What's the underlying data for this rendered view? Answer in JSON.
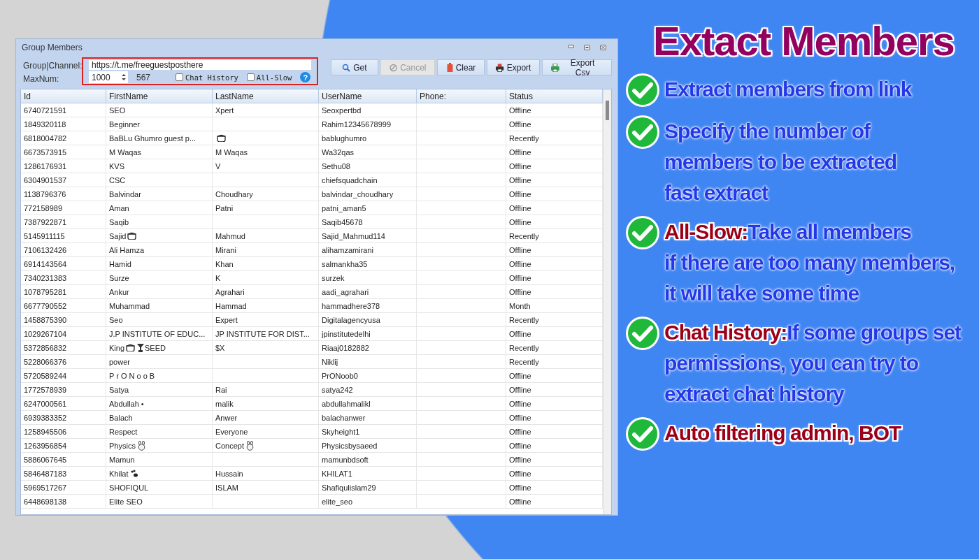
{
  "window": {
    "title": "Group Members"
  },
  "form": {
    "channel_label": "Group|Channel:",
    "channel_value": "https://t.me/freeguestposthere",
    "maxnum_label": "MaxNum:",
    "maxnum_value": "1000",
    "count": "567",
    "help": "?",
    "checkboxes": [
      {
        "label": "Chat History",
        "checked": false
      },
      {
        "label": "All-Slow",
        "checked": false
      }
    ]
  },
  "buttons": [
    {
      "label": "Get",
      "kind": "search",
      "disabled": false
    },
    {
      "label": "Cancel",
      "kind": "cancel",
      "disabled": true
    },
    {
      "label": "Clear",
      "kind": "clear",
      "disabled": false
    },
    {
      "label": "Export",
      "kind": "export",
      "disabled": false
    },
    {
      "label": "Export Csv",
      "kind": "csv",
      "disabled": false
    }
  ],
  "table": {
    "columns": [
      "Id",
      "FirstName",
      "LastName",
      "UserName",
      "Phone:",
      "Status"
    ],
    "rows": [
      [
        "6740721591",
        "SEO",
        "Xpert",
        "Seoxpertbd",
        "",
        "Offline"
      ],
      [
        "1849320118",
        "Beginner",
        "",
        "Rahim12345678999",
        "",
        "Offline"
      ],
      [
        "6818004782",
        "BaBLu Ghumro guest p...",
        [
          {
            "kind": "pot"
          }
        ],
        "bablughumro",
        "",
        "Recently"
      ],
      [
        "6673573915",
        "M Waqas",
        "M Waqas",
        "Wa32qas",
        "",
        "Offline"
      ],
      [
        "1286176931",
        "KVS",
        "V",
        "Sethu08",
        "",
        "Offline"
      ],
      [
        "6304901537",
        "CSC",
        "",
        "chiefsquadchain",
        "",
        "Offline"
      ],
      [
        "1138796376",
        "Balvindar",
        "Choudhary",
        "balvindar_choudhary",
        "",
        "Offline"
      ],
      [
        "772158989",
        "Aman",
        "Patni",
        "patni_aman5",
        "",
        "Offline"
      ],
      [
        "7387922871",
        "Saqib",
        "",
        "Saqib45678",
        "",
        "Offline"
      ],
      [
        "5145911115",
        [
          "Sajid",
          {
            "kind": "pot"
          }
        ],
        "Mahmud",
        "Sajid_Mahmud114",
        "",
        "Recently"
      ],
      [
        "7106132426",
        "Ali Hamza",
        "Mirani",
        "alihamzamirani",
        "",
        "Offline"
      ],
      [
        "6914143564",
        "Hamid",
        "Khan",
        "salmankha35",
        "",
        "Offline"
      ],
      [
        "7340231383",
        "Surze",
        "K",
        "surzek",
        "",
        "Offline"
      ],
      [
        "1078795281",
        "Ankur",
        "Agrahari",
        "aadi_agrahari",
        "",
        "Offline"
      ],
      [
        "6677790552",
        "Muhammad",
        "Hammad",
        "hammadhere378",
        "",
        "Month"
      ],
      [
        "1458875390",
        "Seo",
        "Expert",
        "Digitalagencyusa",
        "",
        "Recently"
      ],
      [
        "1029267104",
        "J.P INSTITUTE OF EDUC...",
        "JP INSTITUTE FOR DIST...",
        "jpinstitutedelhi",
        "",
        "Offline"
      ],
      [
        "5372856832",
        [
          "King",
          {
            "kind": "pot"
          },
          {
            "kind": "trophy"
          },
          "SEED"
        ],
        "$X",
        "Riaaj0182882",
        "",
        "Recently"
      ],
      [
        "5228066376",
        "power",
        "",
        "Niklij",
        "",
        "Recently"
      ],
      [
        "5720589244",
        "P r O N o o B",
        "",
        "PrONoob0",
        "",
        "Offline"
      ],
      [
        "1772578939",
        "Satya",
        "Rai",
        "satya242",
        "",
        "Offline"
      ],
      [
        "6247000561",
        "Abdullah •",
        "malik",
        "abdullahmalikl",
        "",
        "Offline"
      ],
      [
        "6939383352",
        "Balach",
        "Anwer",
        "balachanwer",
        "",
        "Offline"
      ],
      [
        "1258945506",
        "Respect",
        "Everyone",
        "Skyheight1",
        "",
        "Offline"
      ],
      [
        "1263956854",
        [
          "Physics",
          {
            "kind": "bunny"
          }
        ],
        [
          "Concept",
          {
            "kind": "bunny"
          }
        ],
        "Physicsbysaeed",
        "",
        "Offline"
      ],
      [
        "5886067645",
        "Mamun",
        "",
        "mamunbdsoft",
        "",
        "Offline"
      ],
      [
        "5846487183",
        [
          "Khilat",
          {
            "kind": "paw"
          }
        ],
        "Hussain",
        "KHILAT1",
        "",
        "Offline"
      ],
      [
        "5969517267",
        "SHOFIQUL",
        "ISLAM",
        "Shafiqulislam29",
        "",
        "Offline"
      ],
      [
        "6448698138",
        "Elite SEO",
        "",
        "elite_seo",
        "",
        "Offline"
      ]
    ]
  },
  "promo": {
    "title": "Extact Members",
    "items": [
      {
        "lines": [
          "Extract members from link"
        ]
      },
      {
        "lines": [
          "Specify the number of",
          "members to be extracted",
          "fast extract"
        ]
      },
      {
        "highlight": "All-Slow:",
        "lines": [
          "Take all members",
          "if there are too many members,",
          "it will take some time"
        ]
      },
      {
        "highlight": "Chat History:",
        "lines": [
          "If some groups set",
          " permissions, you can try to",
          "extract chat history"
        ]
      },
      {
        "highlight": "Auto filtering admin, BOT"
      }
    ]
  }
}
